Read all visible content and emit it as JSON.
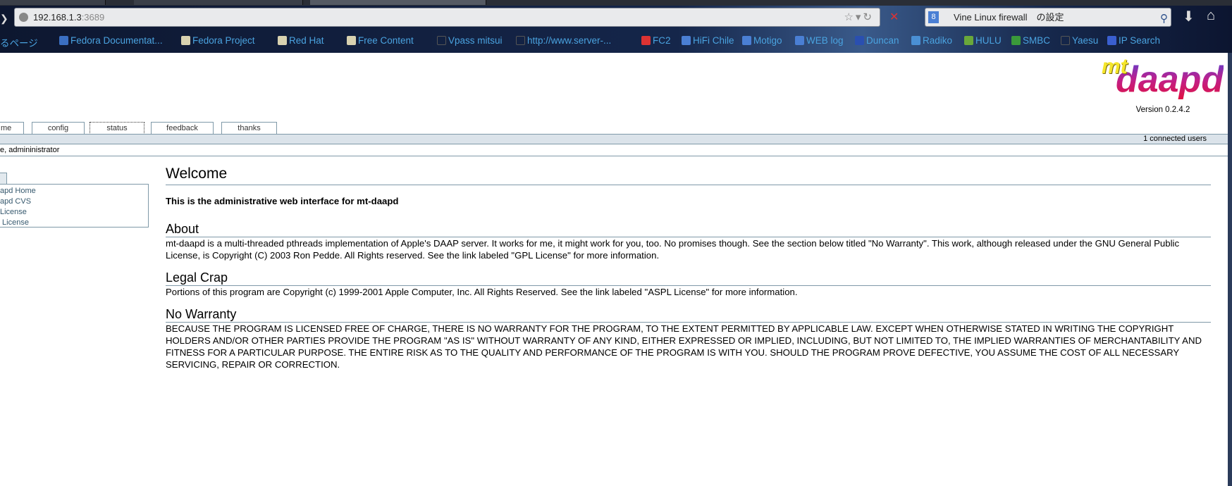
{
  "browser": {
    "url_host": "192.168.1.3",
    "url_port": ":3689",
    "search_text": "Vine Linux firewall　の設定",
    "bookmarks": [
      {
        "label": "るページ",
        "icon": "folder-icon"
      },
      {
        "label": "Fedora Documentat...",
        "icon": "fedora-icon"
      },
      {
        "label": "Fedora Project",
        "icon": "folder-icon"
      },
      {
        "label": "Red Hat",
        "icon": "folder-icon"
      },
      {
        "label": "Free Content",
        "icon": "folder-icon"
      },
      {
        "label": "Vpass mitsui",
        "icon": "page-icon"
      },
      {
        "label": "http://www.server-...",
        "icon": "page-icon"
      },
      {
        "label": "FC2",
        "icon": "fc2-icon"
      },
      {
        "label": "HiFi Chile",
        "icon": "hifi-icon"
      },
      {
        "label": "Motigo",
        "icon": "m-icon"
      },
      {
        "label": "WEB log",
        "icon": "m-icon"
      },
      {
        "label": "Duncan",
        "icon": "duncan-icon"
      },
      {
        "label": "Radiko",
        "icon": "radiko-icon"
      },
      {
        "label": "HULU",
        "icon": "hulu-icon"
      },
      {
        "label": "SMBC",
        "icon": "smbc-icon"
      },
      {
        "label": "Yaesu",
        "icon": "page-icon"
      },
      {
        "label": "IP Search",
        "icon": "c-icon"
      }
    ]
  },
  "page": {
    "logo_mt": "mt",
    "logo_daapd": "daapd",
    "version": "Version 0.2.4.2",
    "tabs": [
      "me",
      "config",
      "status",
      "feedback",
      "thanks"
    ],
    "connected_users": "1 connected users",
    "welcome_user": "e, admininistrator",
    "sidebar_links": [
      "apd Home",
      "apd CVS",
      "License",
      " License"
    ],
    "welcome_title": "Welcome",
    "intro": "This is the administrative web interface for mt-daapd",
    "about_title": "About",
    "about_text": "mt-daapd is a multi-threaded pthreads implementation of Apple's DAAP server. It works for me, it might work for you, too. No promises though. See the section below titled \"No Warranty\". This work, although released under the GNU General Public License, is Copyright (C) 2003 Ron Pedde. All Rights reserved. See the link labeled \"GPL License\" for more information.",
    "legal_title": "Legal Crap",
    "legal_text": "Portions of this program are Copyright (c) 1999-2001 Apple Computer, Inc. All Rights Reserved. See the link labeled \"ASPL License\" for more information.",
    "warranty_title": "No Warranty",
    "warranty_text": "BECAUSE THE PROGRAM IS LICENSED FREE OF CHARGE, THERE IS NO WARRANTY FOR THE PROGRAM, TO THE EXTENT PERMITTED BY APPLICABLE LAW. EXCEPT WHEN OTHERWISE STATED IN WRITING THE COPYRIGHT HOLDERS AND/OR OTHER PARTIES PROVIDE THE PROGRAM \"AS IS\" WITHOUT WARRANTY OF ANY KIND, EITHER EXPRESSED OR IMPLIED, INCLUDING, BUT NOT LIMITED TO, THE IMPLIED WARRANTIES OF MERCHANTABILITY AND FITNESS FOR A PARTICULAR PURPOSE. THE ENTIRE RISK AS TO THE QUALITY AND PERFORMANCE OF THE PROGRAM IS WITH YOU. SHOULD THE PROGRAM PROVE DEFECTIVE, YOU ASSUME THE COST OF ALL NECESSARY SERVICING, REPAIR OR CORRECTION."
  },
  "colors": {
    "border": "#7f99a8",
    "bar": "#dbe3ea",
    "link": "#36596e"
  }
}
